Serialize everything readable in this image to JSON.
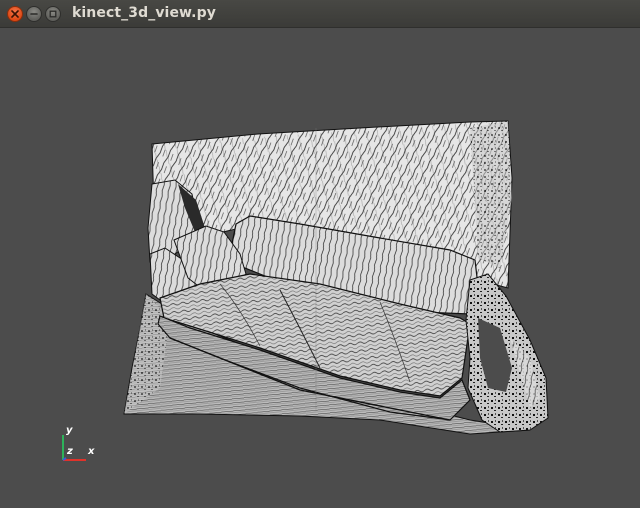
{
  "window": {
    "title": "kinect_3d_view.py",
    "close_icon": "close-icon",
    "minimize_icon": "minimize-icon",
    "maximize_icon": "maximize-icon",
    "accent_close": "#dd4814"
  },
  "viewport": {
    "background": "#4c4c4c",
    "axes": {
      "y_label": "y",
      "z_label": "z",
      "x_label": "x"
    }
  }
}
